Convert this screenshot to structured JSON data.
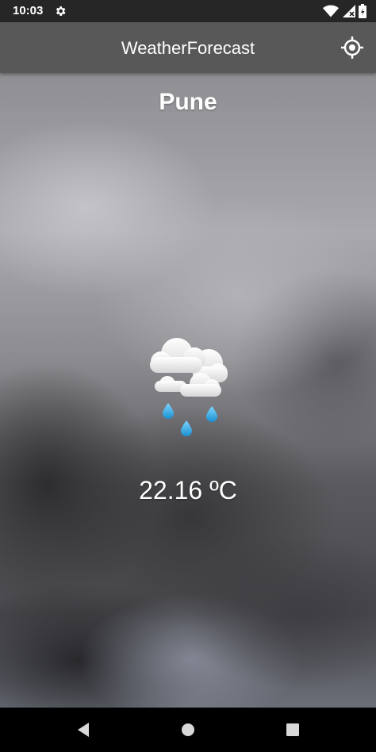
{
  "status_bar": {
    "time": "10:03",
    "icons": [
      "gear-icon",
      "wifi-icon",
      "signal-icon",
      "battery-icon"
    ]
  },
  "app_bar": {
    "title": "WeatherForecast",
    "action_icon": "my-location-icon"
  },
  "weather": {
    "city": "Pune",
    "temperature": "22.16 ºC",
    "condition_icon": "rain-clouds-icon"
  },
  "nav_bar": {
    "buttons": [
      "back-icon",
      "home-icon",
      "recents-icon"
    ]
  },
  "colors": {
    "status_bar": "#262626",
    "app_bar": "#585858",
    "text": "#ffffff",
    "raindrop": "#29a8e0"
  }
}
